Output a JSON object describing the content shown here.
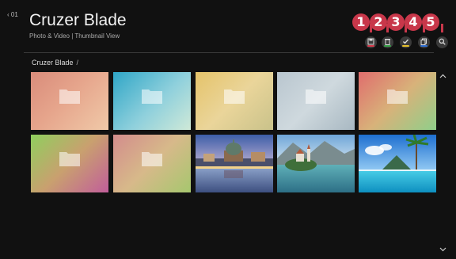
{
  "header": {
    "back_label": "‹ 01",
    "title": "Cruzer Blade",
    "subtitle": "Photo & Video | Thumbnail View"
  },
  "toolbar": {
    "buttons": [
      {
        "icon": "save-icon",
        "badge": "1",
        "accent": "#d83b4c"
      },
      {
        "icon": "delete-icon",
        "badge": "2",
        "accent": "#36a047"
      },
      {
        "icon": "select-icon",
        "badge": "3",
        "accent": "#e6c12c"
      },
      {
        "icon": "copy-icon",
        "badge": "4",
        "accent": "#2f6fd4"
      },
      {
        "icon": "search-icon",
        "badge": "5",
        "accent": "#888888"
      }
    ]
  },
  "breadcrumb": {
    "path": "Cruzer Blade",
    "separator": "/"
  },
  "items": [
    {
      "type": "folder",
      "icon": "folder-icon"
    },
    {
      "type": "folder",
      "icon": "folder-icon"
    },
    {
      "type": "folder",
      "icon": "folder-icon"
    },
    {
      "type": "folder",
      "icon": "folder-icon"
    },
    {
      "type": "folder",
      "icon": "folder-icon"
    },
    {
      "type": "folder",
      "icon": "folder-icon"
    },
    {
      "type": "folder",
      "icon": "folder-icon"
    },
    {
      "type": "photo",
      "icon": "city-photo"
    },
    {
      "type": "photo",
      "icon": "lake-church-photo"
    },
    {
      "type": "photo",
      "icon": "tropical-pool-photo"
    }
  ],
  "scroll": {
    "up_icon": "chevron-up-icon",
    "down_icon": "chevron-down-icon"
  },
  "colors": {
    "badge": "#c8374a",
    "background": "#111111"
  }
}
